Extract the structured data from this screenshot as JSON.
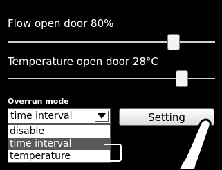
{
  "flow": {
    "label": "Flow open door 80%",
    "value_fraction": 0.8
  },
  "temperature": {
    "label": "Temperature open door 28°C",
    "value_fraction": 0.84
  },
  "overrun": {
    "label": "Overrun mode",
    "selected": "time interval",
    "options": [
      "disable",
      "time interval",
      "temperature"
    ]
  },
  "setting_button": {
    "label": "Setting"
  },
  "icons": {
    "dropdown_arrow": "chevron-down-icon",
    "pointer": "hand-pointer-icon"
  },
  "colors": {
    "background": "#000000",
    "text": "#ffffff",
    "highlight": "#595959"
  }
}
